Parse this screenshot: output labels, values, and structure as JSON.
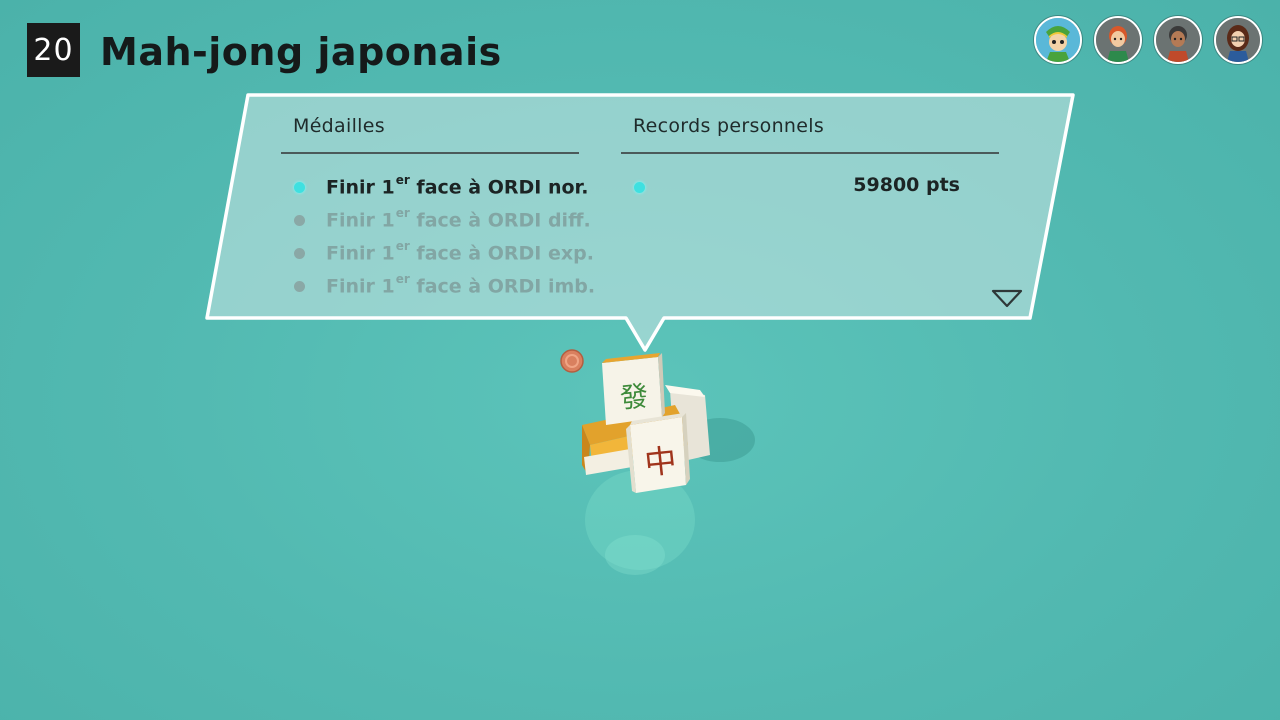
{
  "header": {
    "game_number": "20",
    "title": "Mah-jong japonais"
  },
  "players": [
    {
      "avatar": "link-avatar-icon"
    },
    {
      "avatar": "redhead-mii-avatar-icon"
    },
    {
      "avatar": "dark-hair-mii-avatar-icon"
    },
    {
      "avatar": "brunette-glasses-mii-avatar-icon"
    }
  ],
  "panel": {
    "medals_header": "Médailles",
    "records_header": "Records personnels",
    "medals": [
      {
        "prefix": "Finir 1",
        "sup": "er",
        "suffix": " face à ORDI nor.",
        "earned": true
      },
      {
        "prefix": "Finir 1",
        "sup": "er",
        "suffix": " face à ORDI diff.",
        "earned": false
      },
      {
        "prefix": "Finir 1",
        "sup": "er",
        "suffix": " face à ORDI exp.",
        "earned": false
      },
      {
        "prefix": "Finir 1",
        "sup": "er",
        "suffix": " face à ORDI imb.",
        "earned": false
      }
    ],
    "record_value": "59800 pts"
  },
  "colors": {
    "background": "#52b9b1",
    "earned_dot": "#3fe0e0",
    "earned_text": "#1c2424",
    "locked_text": "#82a6a4"
  }
}
